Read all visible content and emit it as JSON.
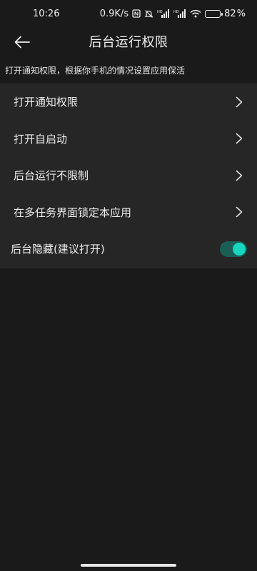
{
  "status_bar": {
    "time": "10:26",
    "network_speed": "0.9K/s",
    "signal_label_1": "HD",
    "signal_label_2": "HD",
    "battery_level": "82",
    "battery_fraction": 0.82
  },
  "header": {
    "title": "后台运行权限",
    "back_icon": "arrow-left-icon"
  },
  "hint": "打开通知权限，根据你手机的情况设置应用保活",
  "settings": {
    "items": [
      {
        "label": "打开通知权限",
        "icon": "chevron-right-icon"
      },
      {
        "label": "打开自启动",
        "icon": "chevron-right-icon"
      },
      {
        "label": "后台运行不限制",
        "icon": "chevron-right-icon"
      },
      {
        "label": "在多任务界面锁定本应用",
        "icon": "chevron-right-icon"
      }
    ],
    "toggle": {
      "label": "后台隐藏(建议打开)",
      "checked": true
    }
  },
  "colors": {
    "background": "#1a1a1a",
    "card": "#262626",
    "accent": "#19d6bf",
    "toggle_track": "#1b5e56"
  }
}
